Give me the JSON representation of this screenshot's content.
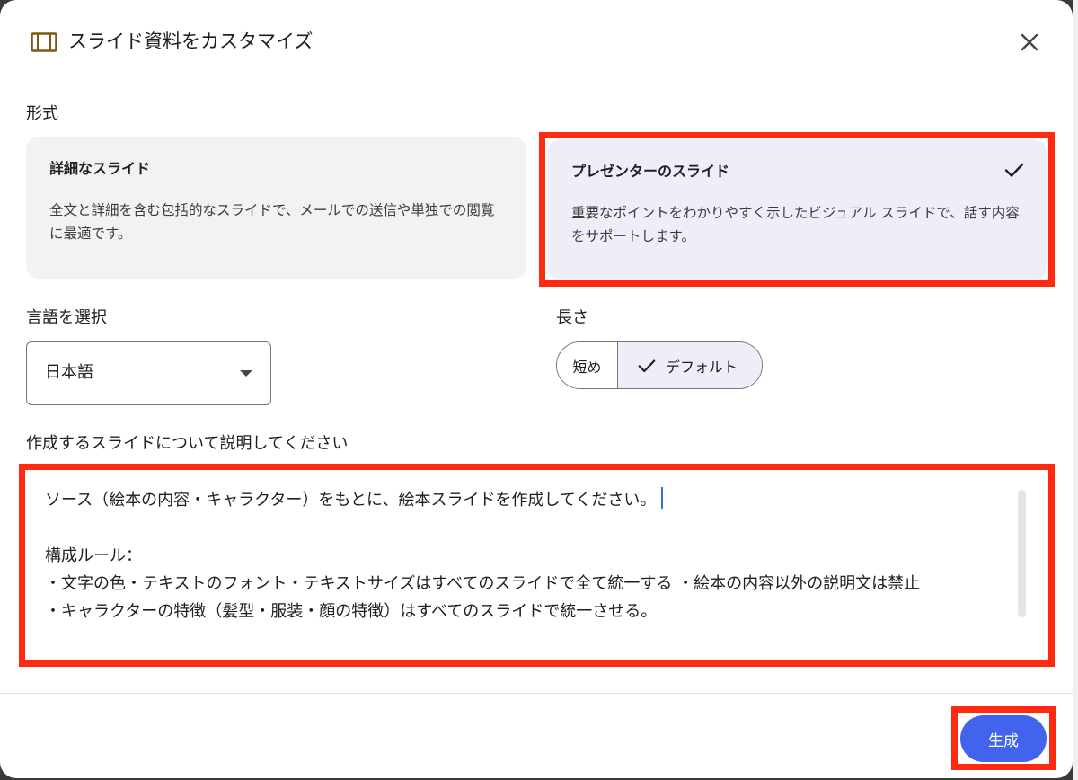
{
  "header": {
    "title": "スライド資料をカスタマイズ",
    "icon": "slides-icon",
    "close_icon": "close-icon"
  },
  "format": {
    "label": "形式",
    "options": [
      {
        "title": "詳細なスライド",
        "description": "全文と詳細を含む包括的なスライドで、メールでの送信や単独での閲覧に最適です。",
        "selected": false
      },
      {
        "title": "プレゼンターのスライド",
        "description": "重要なポイントをわかりやすく示したビジュアル スライドで、話す内容をサポートします。",
        "selected": true
      }
    ]
  },
  "language": {
    "label": "言語を選択",
    "value": "日本語"
  },
  "length": {
    "label": "長さ",
    "options": [
      {
        "label": "短め",
        "selected": false
      },
      {
        "label": "デフォルト",
        "selected": true
      }
    ]
  },
  "description": {
    "label": "作成するスライドについて説明してください",
    "value": "ソース（絵本の内容・キャラクター）をもとに、絵本スライドを作成してください。\n\n構成ルール：\n・文字の色・テキストのフォント・テキストサイズはすべてのスライドで全て統一する ・絵本の内容以外の説明文は禁止\n・キャラクターの特徴（髪型・服装・顔の特徴）はすべてのスライドで統一させる。"
  },
  "footer": {
    "generate_label": "生成"
  },
  "colors": {
    "accent": "#4263eb",
    "selected_bg": "#eeeef9",
    "highlight": "#ff2a10"
  }
}
